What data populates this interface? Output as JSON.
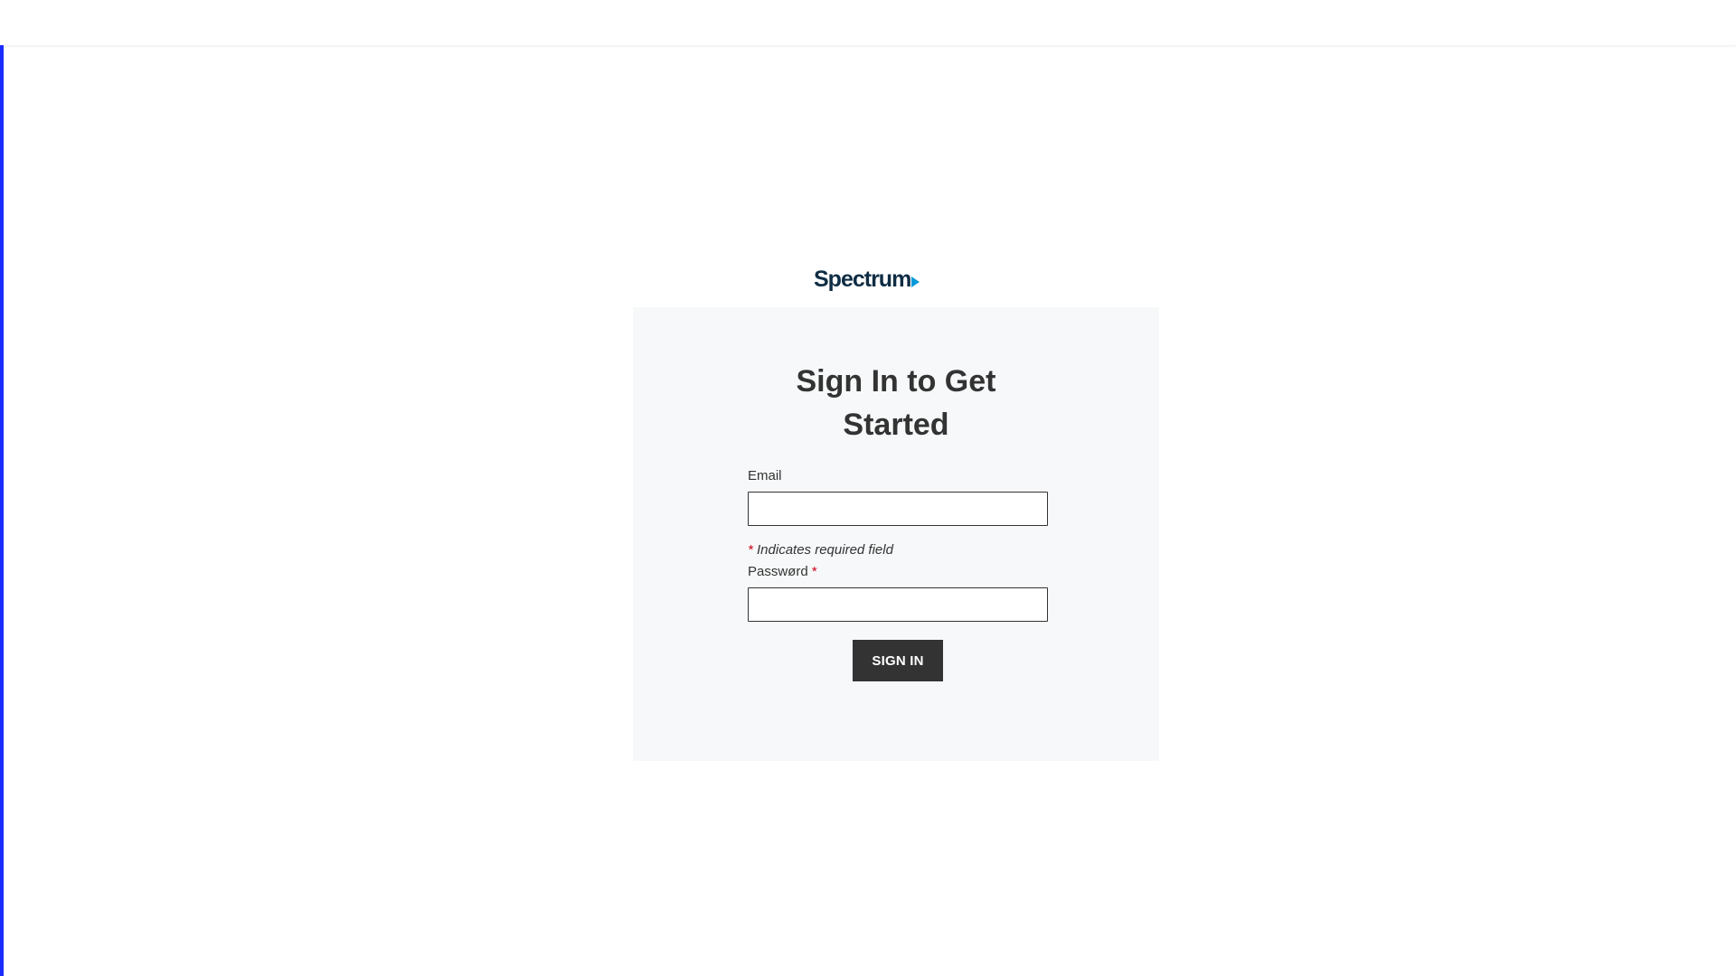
{
  "logo": {
    "text": "Spectrum",
    "colors": {
      "wordmark": "#0f2d44",
      "arrow": "#0099d8"
    }
  },
  "form": {
    "title": "Sign In to Get Started",
    "email_label": "Email",
    "email_value": "",
    "required_marker": "*",
    "required_note": "Indicates required field",
    "password_label": "Passwørd",
    "password_value": "",
    "submit_label": "SIGN IN"
  },
  "colors": {
    "card_background": "#f6f8f9",
    "button_background": "#333333",
    "required": "#d0021b",
    "focus_edge": "#1a2cff"
  }
}
